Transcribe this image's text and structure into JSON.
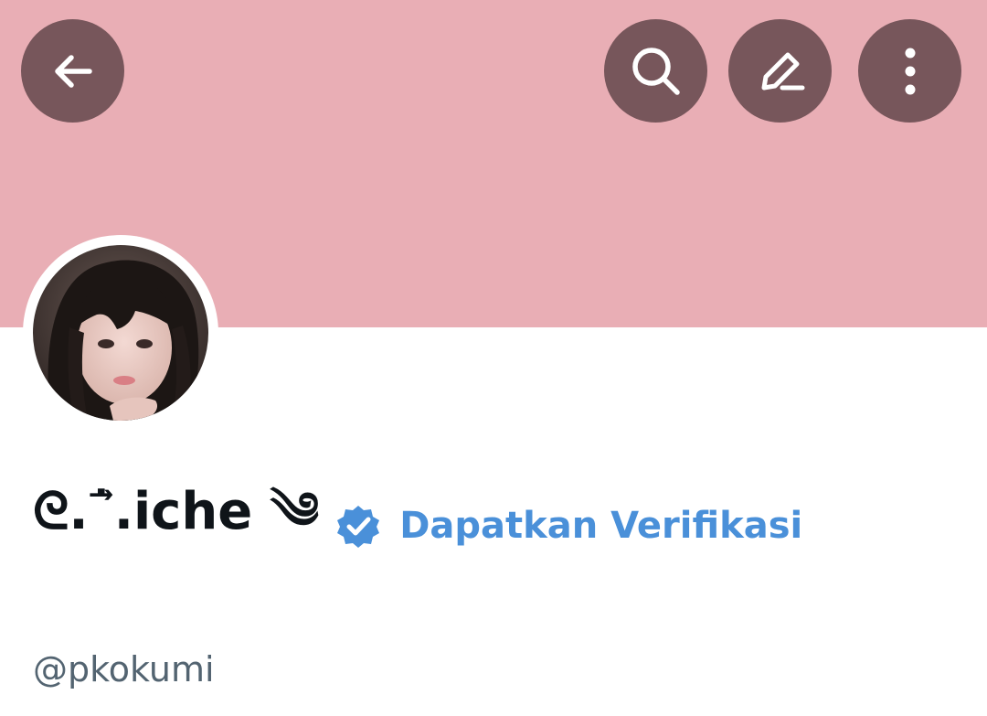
{
  "header": {
    "back_icon": "arrow-left-icon",
    "search_icon": "search-icon",
    "edit_icon": "pencil-icon",
    "more_icon": "more-vertical-icon",
    "banner_color": "#e9aeb5",
    "button_color": "#77565b"
  },
  "profile": {
    "display_name": "ᘓ.˙⃗.iche ༄",
    "verified_icon": "verified-badge-icon",
    "get_verified_label": "Dapatkan Verifikasi",
    "handle": "@pkokumi",
    "accent_color": "#4a90d9"
  }
}
